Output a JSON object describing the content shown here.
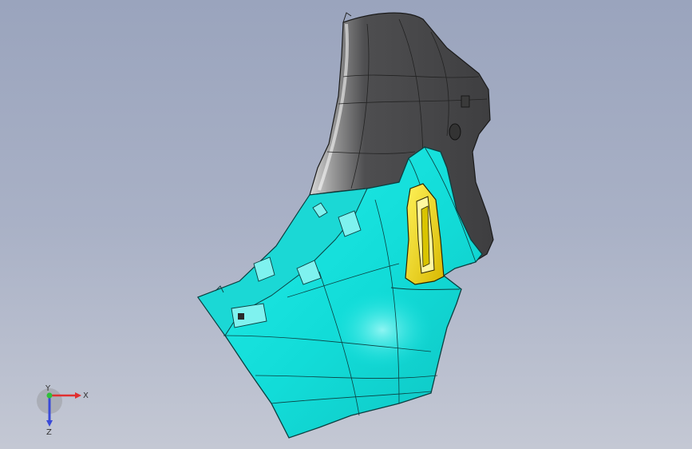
{
  "viewport": {
    "background_top": "#9aa4bd",
    "background_bottom": "#c4c8d4"
  },
  "model": {
    "parts": [
      {
        "name": "dark-housing",
        "color": "#4a4a4c"
      },
      {
        "name": "cyan-bezel",
        "color": "#19e6e3"
      },
      {
        "name": "yellow-handle",
        "color": "#f2d80c"
      }
    ]
  },
  "triad": {
    "x_label": "X",
    "y_label": "Y",
    "z_label": "Z",
    "x_color": "#e03030",
    "y_color": "#2fbf3a",
    "z_color": "#3a4ad8"
  }
}
